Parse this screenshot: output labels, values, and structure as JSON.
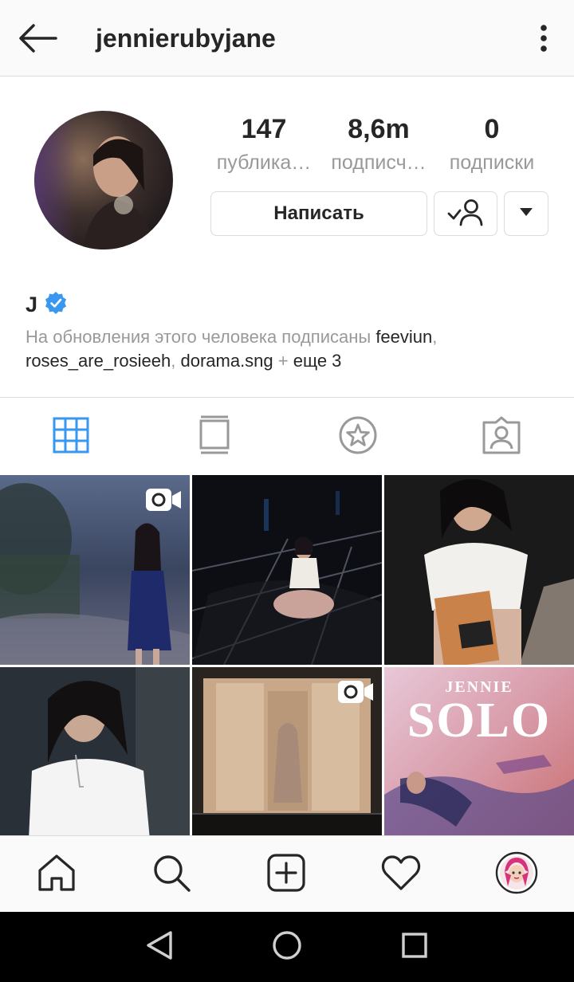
{
  "header": {
    "username": "jennierubyjane",
    "back_icon": "arrow-left-icon",
    "more_icon": "more-vertical-icon"
  },
  "profile": {
    "stats": [
      {
        "number": "147",
        "label": "публика…"
      },
      {
        "number": "8,6m",
        "label": "подписч…"
      },
      {
        "number": "0",
        "label": "подписки"
      }
    ],
    "message_button": "Написать",
    "follow_icon": "following-user-check-icon",
    "dropdown_icon": "caret-down-icon",
    "display_name": "J",
    "verified_icon": "verified-badge-icon",
    "followed_by": {
      "prefix": "На обновления этого человека подписаны ",
      "user1": "feeviun",
      "sep1": ",",
      "user2": "roses_are_rosieeh",
      "sep2": ", ",
      "user3": "dorama.sng",
      "plus": " + ",
      "more": "еще 3"
    }
  },
  "tabs": [
    {
      "name": "grid",
      "icon": "grid-icon",
      "active": true
    },
    {
      "name": "feed",
      "icon": "feed-icon",
      "active": false
    },
    {
      "name": "saved",
      "icon": "star-icon",
      "active": false
    },
    {
      "name": "tagged",
      "icon": "tagged-person-icon",
      "active": false
    }
  ],
  "grid": {
    "posts": [
      {
        "type": "video",
        "icon": "video-camera-icon"
      },
      {
        "type": "image"
      },
      {
        "type": "image"
      },
      {
        "type": "image"
      },
      {
        "type": "video",
        "icon": "video-camera-icon"
      },
      {
        "type": "image",
        "overlay_small": "JENNIE",
        "overlay_big": "SOLO"
      }
    ]
  },
  "bottom_nav": [
    {
      "name": "home",
      "icon": "home-icon"
    },
    {
      "name": "search",
      "icon": "search-icon"
    },
    {
      "name": "new-post",
      "icon": "plus-square-icon"
    },
    {
      "name": "activity",
      "icon": "heart-icon"
    },
    {
      "name": "profile",
      "icon": "profile-avatar-icon"
    }
  ],
  "system_nav": [
    {
      "name": "back",
      "icon": "triangle-back-icon"
    },
    {
      "name": "home",
      "icon": "circle-home-icon"
    },
    {
      "name": "recents",
      "icon": "square-recents-icon"
    }
  ],
  "colors": {
    "accent_blue": "#3897f0",
    "text_primary": "#262626",
    "text_secondary": "#999999",
    "border": "#dbdbdb"
  }
}
